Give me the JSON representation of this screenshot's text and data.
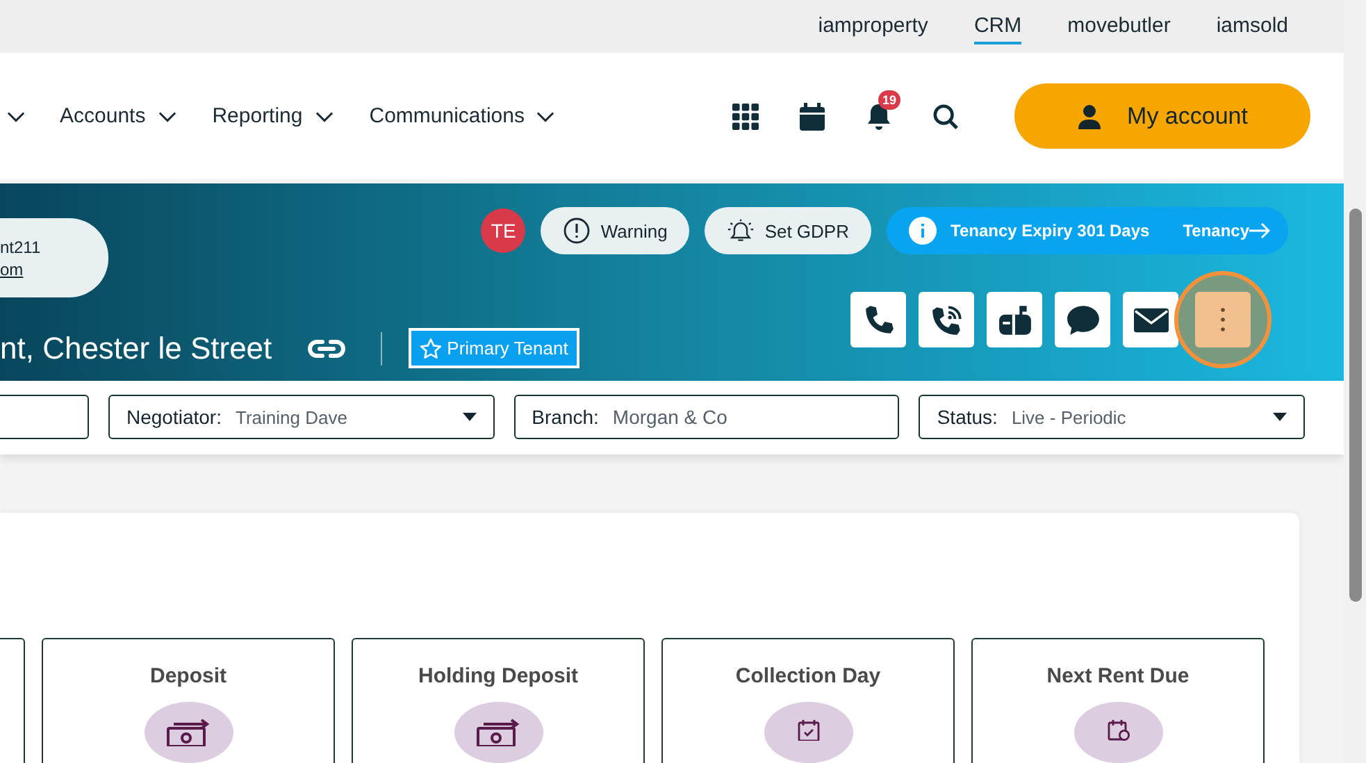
{
  "top_links": [
    {
      "label": "iamproperty",
      "selected": false
    },
    {
      "label": "CRM",
      "selected": true
    },
    {
      "label": "movebutler",
      "selected": false
    },
    {
      "label": "iamsold",
      "selected": false
    }
  ],
  "nav": {
    "items": [
      {
        "label": "Accounts"
      },
      {
        "label": "Reporting"
      },
      {
        "label": "Communications"
      }
    ],
    "notification_count": "19",
    "account_button": "My account"
  },
  "hero": {
    "contact": {
      "line": "nt211",
      "link": "om"
    },
    "title": "nt, Chester le Street",
    "primary_label": "Primary Tenant",
    "avatar_initials": "TE",
    "badges": [
      {
        "kind": "warning",
        "label": "Warning"
      },
      {
        "kind": "gdpr",
        "label": "Set GDPR"
      }
    ],
    "expiry": {
      "text": "Tenancy Expiry 301 Days",
      "link": "Tenancy"
    },
    "actions": [
      {
        "kind": "phone"
      },
      {
        "kind": "phone-wave"
      },
      {
        "kind": "mailbox"
      },
      {
        "kind": "chat"
      },
      {
        "kind": "email"
      },
      {
        "kind": "more",
        "highlighted": true
      }
    ]
  },
  "filters": [
    {
      "kind": "dropdown",
      "label": "Negotiator:",
      "value": "Training Dave"
    },
    {
      "kind": "text",
      "label": "Branch:",
      "value": "Morgan & Co"
    },
    {
      "kind": "dropdown",
      "label": "Status:",
      "value": "Live - Periodic"
    }
  ],
  "stats": [
    {
      "title": "Deposit",
      "kind": "money"
    },
    {
      "title": "Holding Deposit",
      "kind": "money"
    },
    {
      "title": "Collection Day",
      "kind": "calendar-check"
    },
    {
      "title": "Next Rent Due",
      "kind": "calendar-clock"
    }
  ]
}
